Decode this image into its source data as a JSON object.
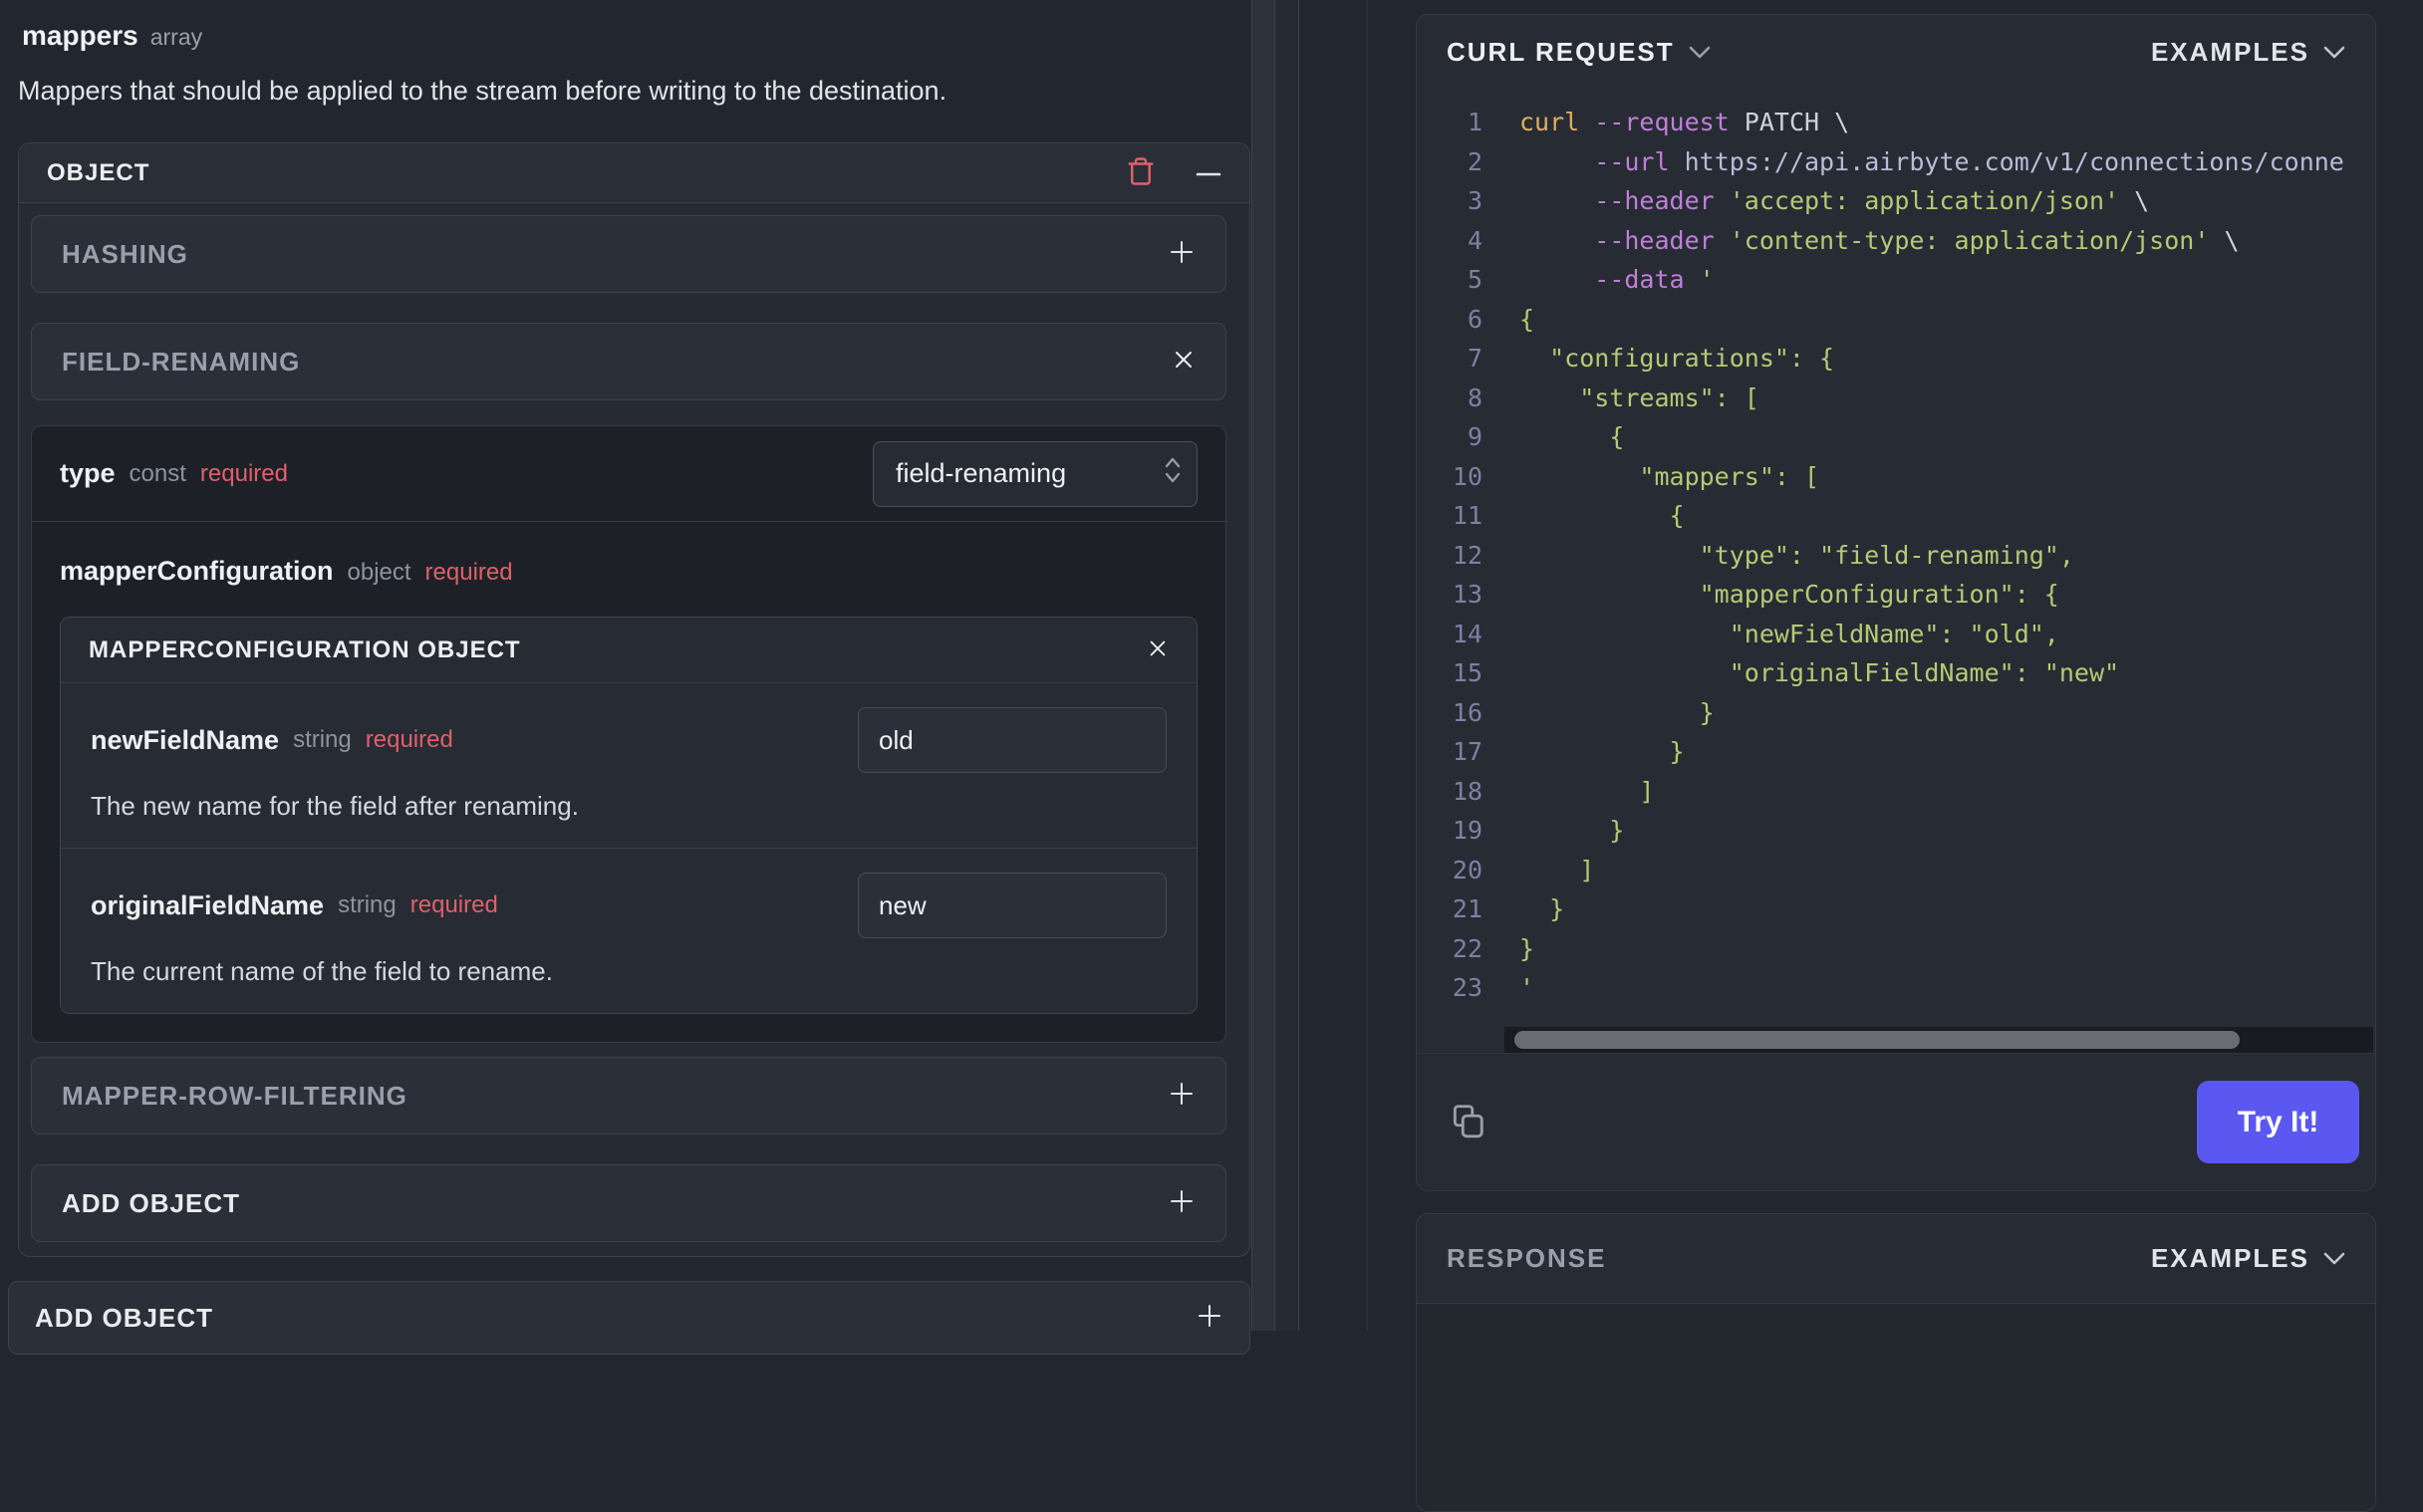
{
  "colors": {
    "accent_blue": "#5a58f0",
    "required_red": "#e0606a",
    "trash_red": "#dd606a",
    "code": {
      "cmd": "#e2ae5f",
      "flag": "#c07fd9",
      "plain": "#ced2da",
      "url": "#b9bcd9",
      "str": "#b3cb74",
      "line_number": "#7c81a2"
    }
  },
  "left_panel": {
    "title": "mappers",
    "title_type": "array",
    "description": "Mappers that should be applied to the stream before writing to the destination.",
    "object_header": "OBJECT",
    "hashing_label": "HASHING",
    "field_renaming": {
      "label": "FIELD-RENAMING",
      "type_field": {
        "name": "type",
        "kind": "const",
        "required": "required",
        "value": "field-renaming"
      },
      "mapper_config": {
        "name": "mapperConfiguration",
        "kind": "object",
        "required": "required",
        "panel_title": "MAPPERCONFIGURATION OBJECT",
        "fields": [
          {
            "name": "newFieldName",
            "kind": "string",
            "required": "required",
            "value": "old",
            "description": "The new name for the field after renaming."
          },
          {
            "name": "originalFieldName",
            "kind": "string",
            "required": "required",
            "value": "new",
            "description": "The current name of the field to rename."
          }
        ]
      }
    },
    "mapper_row_filtering_label": "MAPPER-ROW-FILTERING",
    "add_object_inner_label": "ADD OBJECT",
    "add_object_outer_label": "ADD OBJECT"
  },
  "right_panel": {
    "curl_card": {
      "title": "CURL REQUEST",
      "examples_label": "EXAMPLES",
      "try_it_label": "Try It!",
      "code_lines": [
        {
          "num": 1,
          "segments": [
            {
              "text": "curl ",
              "color": "cmd"
            },
            {
              "text": "--request",
              "color": "flag"
            },
            {
              "text": " PATCH \\",
              "color": "plain"
            }
          ]
        },
        {
          "num": 2,
          "segments": [
            {
              "text": "     ",
              "color": "plain"
            },
            {
              "text": "--url",
              "color": "flag"
            },
            {
              "text": " ",
              "color": "plain"
            },
            {
              "text": "https://api.airbyte.com/v1/connections/conne",
              "color": "url"
            }
          ]
        },
        {
          "num": 3,
          "segments": [
            {
              "text": "     ",
              "color": "plain"
            },
            {
              "text": "--header",
              "color": "flag"
            },
            {
              "text": " ",
              "color": "plain"
            },
            {
              "text": "'accept: application/json'",
              "color": "str"
            },
            {
              "text": " \\",
              "color": "plain"
            }
          ]
        },
        {
          "num": 4,
          "segments": [
            {
              "text": "     ",
              "color": "plain"
            },
            {
              "text": "--header",
              "color": "flag"
            },
            {
              "text": " ",
              "color": "plain"
            },
            {
              "text": "'content-type: application/json'",
              "color": "str"
            },
            {
              "text": " \\",
              "color": "plain"
            }
          ]
        },
        {
          "num": 5,
          "segments": [
            {
              "text": "     ",
              "color": "plain"
            },
            {
              "text": "--data",
              "color": "flag"
            },
            {
              "text": " ",
              "color": "plain"
            },
            {
              "text": "'",
              "color": "str"
            }
          ]
        },
        {
          "num": 6,
          "segments": [
            {
              "text": "{",
              "color": "str"
            }
          ]
        },
        {
          "num": 7,
          "segments": [
            {
              "text": "  \"configurations\": {",
              "color": "str"
            }
          ]
        },
        {
          "num": 8,
          "segments": [
            {
              "text": "    \"streams\": [",
              "color": "str"
            }
          ]
        },
        {
          "num": 9,
          "segments": [
            {
              "text": "      {",
              "color": "str"
            }
          ]
        },
        {
          "num": 10,
          "segments": [
            {
              "text": "        \"mappers\": [",
              "color": "str"
            }
          ]
        },
        {
          "num": 11,
          "segments": [
            {
              "text": "          {",
              "color": "str"
            }
          ]
        },
        {
          "num": 12,
          "segments": [
            {
              "text": "            \"type\": \"field-renaming\",",
              "color": "str"
            }
          ]
        },
        {
          "num": 13,
          "segments": [
            {
              "text": "            \"mapperConfiguration\": {",
              "color": "str"
            }
          ]
        },
        {
          "num": 14,
          "segments": [
            {
              "text": "              \"newFieldName\": \"old\",",
              "color": "str"
            }
          ]
        },
        {
          "num": 15,
          "segments": [
            {
              "text": "              \"originalFieldName\": \"new\"",
              "color": "str"
            }
          ]
        },
        {
          "num": 16,
          "segments": [
            {
              "text": "            }",
              "color": "str"
            }
          ]
        },
        {
          "num": 17,
          "segments": [
            {
              "text": "          }",
              "color": "str"
            }
          ]
        },
        {
          "num": 18,
          "segments": [
            {
              "text": "        ]",
              "color": "str"
            }
          ]
        },
        {
          "num": 19,
          "segments": [
            {
              "text": "      }",
              "color": "str"
            }
          ]
        },
        {
          "num": 20,
          "segments": [
            {
              "text": "    ]",
              "color": "str"
            }
          ]
        },
        {
          "num": 21,
          "segments": [
            {
              "text": "  }",
              "color": "str"
            }
          ]
        },
        {
          "num": 22,
          "segments": [
            {
              "text": "}",
              "color": "str"
            }
          ]
        },
        {
          "num": 23,
          "segments": [
            {
              "text": "'",
              "color": "str"
            }
          ]
        }
      ]
    },
    "response_card": {
      "title": "RESPONSE",
      "examples_label": "EXAMPLES"
    }
  }
}
